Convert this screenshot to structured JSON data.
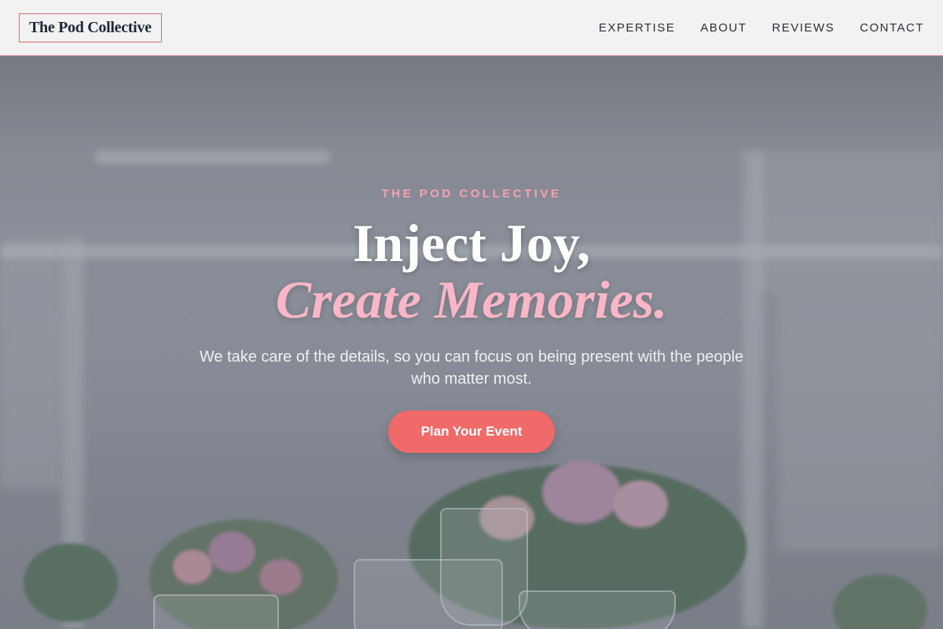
{
  "header": {
    "logo_text": "The Pod Collective",
    "nav": [
      {
        "label": "EXPERTISE"
      },
      {
        "label": "ABOUT"
      },
      {
        "label": "REVIEWS"
      },
      {
        "label": "CONTACT"
      }
    ]
  },
  "hero": {
    "eyebrow": "THE POD COLLECTIVE",
    "headline_line1": "Inject Joy,",
    "headline_line2": "Create Memories.",
    "subtext": "We take care of the details, so you can focus on being present with the people who matter most.",
    "cta_label": "Plan Your Event"
  },
  "colors": {
    "accent": "#f06a6a",
    "pink_text": "#f8b6c6",
    "eyebrow": "#f4a3b2",
    "logo_border": "#d9696f"
  }
}
